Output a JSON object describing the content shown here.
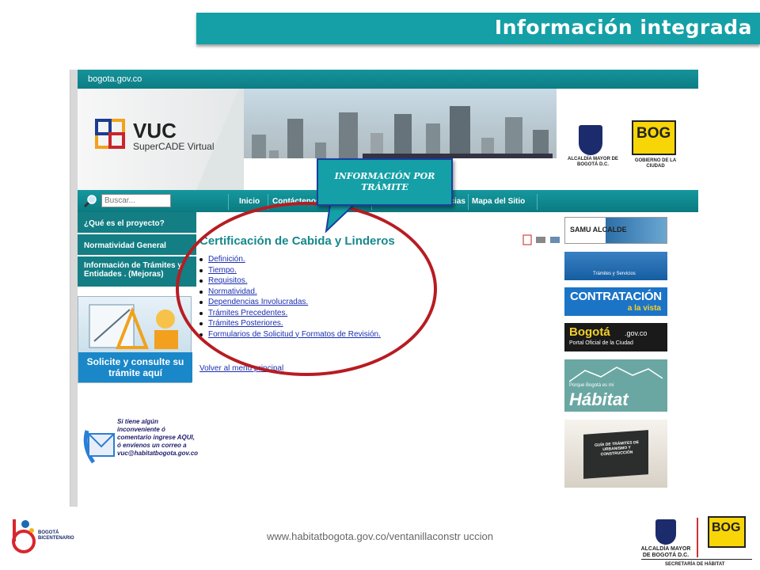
{
  "slide": {
    "title": "Información integrada",
    "footer_url": "www.habitatbogota.gov.co/ventanillaconstr uccion",
    "callout": "INFORMACIÓN POR TRÁMITE"
  },
  "site": {
    "topbar": "bogota.gov.co",
    "logo_title": "VUC",
    "logo_subtitle": "SuperCADE Virtual",
    "alcaldia": "ALCALDÍA MAYOR DE BOGOTÁ D.C.",
    "bog": "BOG",
    "bog_sub": "GOBIERNO DE LA CIUDAD",
    "search": {
      "placeholder": "Buscar..."
    },
    "nav": [
      "Inicio",
      "Contáctenos",
      "Noticias",
      "Mapa del Sitio"
    ],
    "sidebar": [
      {
        "label": "¿Qué es el proyecto?"
      },
      {
        "label": "Normatividad General"
      },
      {
        "label": "Información de Trámites y Entidades . (Mejoras)"
      }
    ],
    "solicite": "Solicite y consulte su trámite aquí",
    "contact": "Si tiene algún inconveniente ó comentario ingrese AQUI, ó envíenos un correo a vuc@habitatbogota.gov.co",
    "main_title": "Certificación de Cabida y Linderos",
    "links": [
      "Definición.",
      "Tiempo.",
      "Requisitos.",
      "Normatividad.",
      "Dependencias Involucradas.",
      "Trámites Precedentes.",
      "Trámites Posteriores.",
      "Formularios de Solicitud y Formatos de Revisión."
    ],
    "back": "Volver al menú principal",
    "banners": {
      "samu": "SAMU ALCALDE",
      "tramites": "Trámites y Servicios",
      "contratacion": "CONTRATACIÓN",
      "contratacion_sub": "a la vista",
      "bogota": "Bogotá",
      "bogota_domain": ".gov.co",
      "bogota_sub": "Portal Oficial de la Ciudad",
      "habitat_sub": "Porque Bogotá es mi",
      "habitat": "Hábitat",
      "guia": "GUÍA DE TRÁMITES DE URBANISMO Y CONSTRUCCIÓN"
    }
  },
  "footer": {
    "bicentenario": "BOGOTÁ BICENTENARIO",
    "alcaldia": "ALCALDÍA MAYOR DE BOGOTÁ D.C.",
    "bog": "BOG",
    "secretaria": "SECRETARÍA DE HÁBITAT"
  },
  "colors": {
    "teal": "#14a0a6",
    "red_highlight": "#b71c22",
    "link": "#1b2fb0"
  }
}
